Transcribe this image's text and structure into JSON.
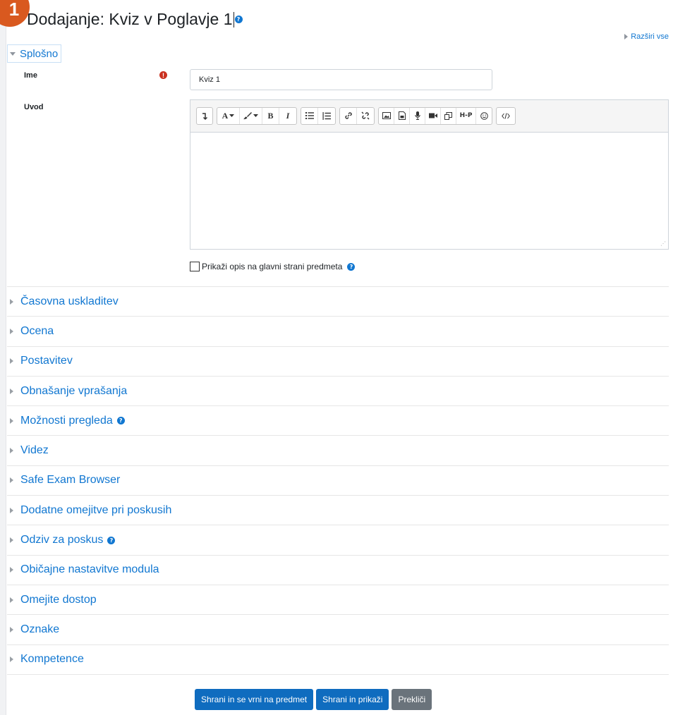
{
  "page": {
    "title": "Dodajanje: Kviz v Poglavje 1",
    "step_number": "1",
    "expand_all": "Razširi vse",
    "help_glyph": "?",
    "required_glyph": "!"
  },
  "general": {
    "heading": "Splošno",
    "name_label": "Ime",
    "name_value": "Kviz 1",
    "intro_label": "Uvod",
    "toolbar": {
      "font_label": "A",
      "bold": "B",
      "italic": "I",
      "h5p": "H-P",
      "icons": [
        "collapse-icon",
        "font-color-icon",
        "paintbrush-icon",
        "bold-icon",
        "italic-icon",
        "unordered-list-icon",
        "ordered-list-icon",
        "link-icon",
        "unlink-icon",
        "image-icon",
        "document-icon",
        "microphone-icon",
        "video-camera-icon",
        "copy-icon",
        "h5p-icon",
        "emoji-icon",
        "html-icon"
      ]
    },
    "show_description_label": "Prikaži opis na glavni strani predmeta"
  },
  "sections": [
    {
      "label": "Časovna uskladitev",
      "help": false
    },
    {
      "label": "Ocena",
      "help": false
    },
    {
      "label": "Postavitev",
      "help": false
    },
    {
      "label": "Obnašanje vprašanja",
      "help": false
    },
    {
      "label": "Možnosti pregleda",
      "help": true
    },
    {
      "label": "Videz",
      "help": false
    },
    {
      "label": "Safe Exam Browser",
      "help": false
    },
    {
      "label": "Dodatne omejitve pri poskusih",
      "help": false
    },
    {
      "label": "Odziv za poskus",
      "help": true
    },
    {
      "label": "Običajne nastavitve modula",
      "help": false
    },
    {
      "label": "Omejite dostop",
      "help": false
    },
    {
      "label": "Oznake",
      "help": false
    },
    {
      "label": "Kompetence",
      "help": false
    }
  ],
  "buttons": {
    "save_return": "Shrani in se vrni na predmet",
    "save_display": "Shrani in prikaži",
    "cancel": "Prekliči"
  },
  "colors": {
    "link": "#1177d1",
    "primary_button": "#0f6cbf",
    "secondary_button": "#6a737b",
    "required": "#ca3120",
    "step_badge": "#d9591f"
  }
}
